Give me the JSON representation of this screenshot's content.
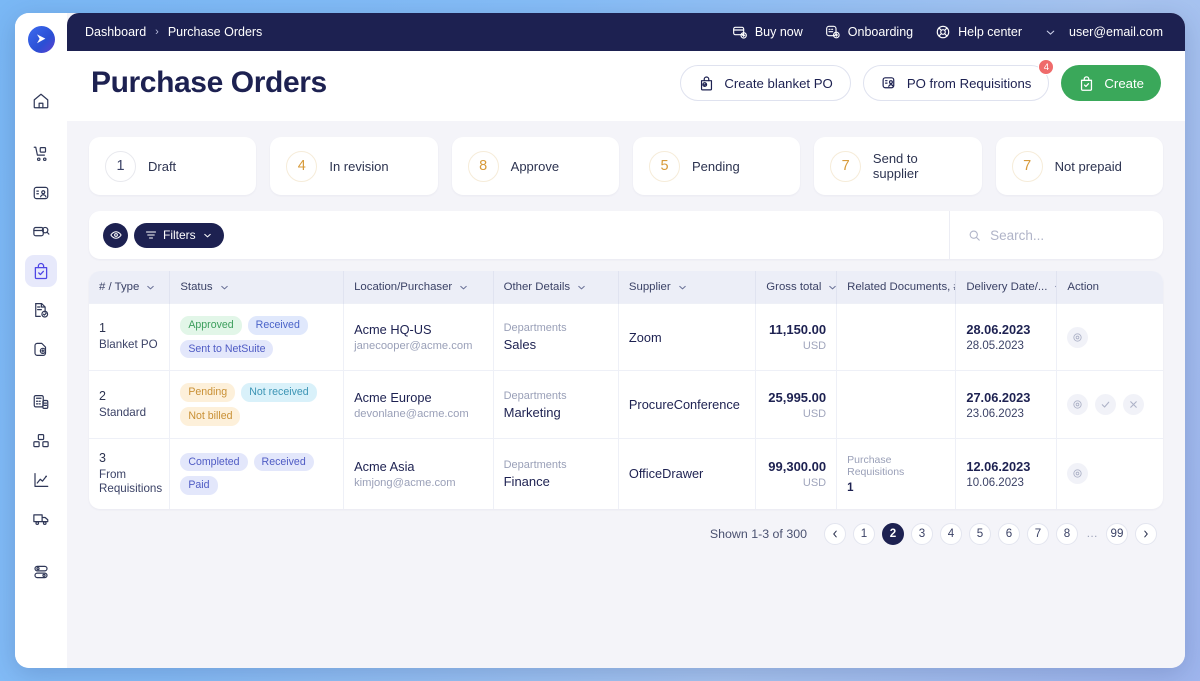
{
  "brand": {
    "logo_icon": "play-triangle-logo"
  },
  "sidebar": {
    "items": [
      {
        "icon": "home-icon",
        "name": "home"
      },
      {
        "icon": "delivery-cart-icon",
        "name": "receiving"
      },
      {
        "icon": "contact-card-icon",
        "name": "suppliers"
      },
      {
        "icon": "document-search-icon",
        "name": "requisitions"
      },
      {
        "icon": "clipboard-check-icon",
        "name": "purchase-orders"
      },
      {
        "icon": "file-check-icon",
        "name": "invoices"
      },
      {
        "icon": "file-lock-icon",
        "name": "contracts"
      },
      {
        "icon": "calculator-icon",
        "name": "budgets"
      },
      {
        "icon": "inventory-boxes-icon",
        "name": "inventory"
      },
      {
        "icon": "line-chart-icon",
        "name": "analytics"
      },
      {
        "icon": "truck-icon",
        "name": "logistics"
      },
      {
        "icon": "toggles-icon",
        "name": "settings"
      }
    ]
  },
  "topbar": {
    "breadcrumb": {
      "root": "Dashboard",
      "separator": "›",
      "current": "Purchase Orders"
    },
    "links": [
      {
        "label": "Buy now",
        "icon": "card-buy-icon"
      },
      {
        "label": "Onboarding",
        "icon": "onboarding-chat-icon"
      },
      {
        "label": "Help center",
        "icon": "lifebuoy-icon"
      }
    ],
    "user": {
      "email": "user@email.com",
      "chevron": "chevron-down-icon"
    }
  },
  "header": {
    "title": "Purchase Orders",
    "actions": {
      "blanket_po": {
        "label": "Create blanket PO",
        "icon": "bag-check-icon"
      },
      "po_from_requisitions": {
        "label": "PO from Requisitions",
        "icon": "requisition-card-icon",
        "badge": "4"
      },
      "create": {
        "label": "Create",
        "icon": "clipboard-check-icon"
      }
    }
  },
  "stats": [
    {
      "count": "1",
      "label": "Draft",
      "color": "#3b4266",
      "ring": "#e8e9ee"
    },
    {
      "count": "4",
      "label": "In revision",
      "color": "#d79a3a",
      "ring": "#f6ecd9"
    },
    {
      "count": "8",
      "label": "Approve",
      "color": "#d79a3a",
      "ring": "#f6ecd9"
    },
    {
      "count": "5",
      "label": "Pending",
      "color": "#d79a3a",
      "ring": "#f6ecd9"
    },
    {
      "count": "7",
      "label": "Send to supplier",
      "color": "#d79a3a",
      "ring": "#f6ecd9"
    },
    {
      "count": "7",
      "label": "Not prepaid",
      "color": "#d79a3a",
      "ring": "#f6ecd9"
    }
  ],
  "toolbar": {
    "visibility_icon": "eye-icon",
    "filters_label": "Filters",
    "filters_icon": "filter-icon",
    "filters_chevron": "chevron-down-icon",
    "search": {
      "placeholder": "Search...",
      "value": "",
      "icon": "search-icon"
    }
  },
  "table": {
    "columns": [
      {
        "label": "# / Type",
        "sortable": true
      },
      {
        "label": "Status",
        "sortable": true
      },
      {
        "label": "Location/Purchaser",
        "sortable": true
      },
      {
        "label": "Other Details",
        "sortable": true
      },
      {
        "label": "Supplier",
        "sortable": true
      },
      {
        "label": "Gross total",
        "sortable": true
      },
      {
        "label": "Related Documents, #",
        "sortable": false
      },
      {
        "label": "Delivery Date/...",
        "sortable": true
      },
      {
        "label": "Action",
        "sortable": false
      }
    ],
    "rows": [
      {
        "number": "1",
        "type": "Blanket PO",
        "chips": [
          {
            "text": "Approved",
            "style": "green"
          },
          {
            "text": "Received",
            "style": "blue"
          },
          {
            "text": "Sent to NetSuite",
            "style": "indigo"
          }
        ],
        "location": "Acme HQ-US",
        "email": "janecooper@acme.com",
        "other_label": "Departments",
        "other_value": "Sales",
        "supplier": "Zoom",
        "gross_total": "11,150.00",
        "currency": "USD",
        "related_label": "",
        "related_value": "",
        "delivery_date": "28.06.2023",
        "delivery_sub": "28.05.2023",
        "actions": [
          "eye-icon"
        ]
      },
      {
        "number": "2",
        "type": "Standard",
        "chips": [
          {
            "text": "Pending",
            "style": "amber"
          },
          {
            "text": "Not received",
            "style": "cyan"
          },
          {
            "text": "Not billed",
            "style": "amber"
          }
        ],
        "location": "Acme Europe",
        "email": "devonlane@acme.com",
        "other_label": "Departments",
        "other_value": "Marketing",
        "supplier": "ProcureConference",
        "gross_total": "25,995.00",
        "currency": "USD",
        "related_label": "",
        "related_value": "",
        "delivery_date": "27.06.2023",
        "delivery_sub": "23.06.2023",
        "actions": [
          "eye-icon",
          "check-icon",
          "close-icon"
        ]
      },
      {
        "number": "3",
        "type": "From Requisitions",
        "chips": [
          {
            "text": "Completed",
            "style": "indigo"
          },
          {
            "text": "Received",
            "style": "indigo"
          },
          {
            "text": "Paid",
            "style": "indigo"
          }
        ],
        "location": "Acme Asia",
        "email": "kimjong@acme.com",
        "other_label": "Departments",
        "other_value": "Finance",
        "supplier": "OfficeDrawer",
        "gross_total": "99,300.00",
        "currency": "USD",
        "related_label": "Purchase Requisitions",
        "related_value": "1",
        "delivery_date": "12.06.2023",
        "delivery_sub": "10.06.2023",
        "actions": [
          "eye-icon"
        ]
      }
    ]
  },
  "pagination": {
    "shown_text": "Shown 1-3 of 300",
    "prev_icon": "chevron-left-icon",
    "next_icon": "chevron-right-icon",
    "pages": [
      "1",
      "2",
      "3",
      "4",
      "5",
      "6",
      "7",
      "8",
      "…",
      "99"
    ],
    "active": "2"
  },
  "colors": {
    "topbar_bg": "#1d2151",
    "primary_green": "#3aa85a",
    "badge_red": "#ef6b6b",
    "accent_indigo": "#4f46e5"
  }
}
